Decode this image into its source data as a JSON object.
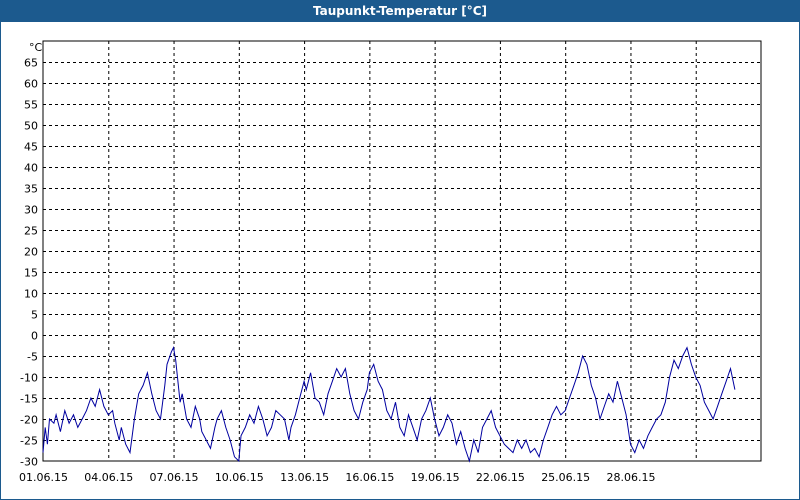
{
  "window": {
    "title": "Taupunkt-Temperatur [°C]"
  },
  "colors": {
    "titlebar": "#1c5a8e",
    "series": "#0000a0",
    "grid": "#000000"
  },
  "chart_data": {
    "type": "line",
    "title": "Taupunkt-Temperatur [°C]",
    "ylabel": "°C",
    "xlabel": "",
    "ylim": [
      -30,
      70
    ],
    "yticks": [
      65,
      60,
      55,
      50,
      45,
      40,
      35,
      30,
      25,
      20,
      15,
      10,
      5,
      0,
      -5,
      -10,
      -15,
      -20,
      -25,
      -30
    ],
    "xlim": [
      "2015-06-01",
      "2015-07-01"
    ],
    "xticks": [
      "01.06.15",
      "04.06.15",
      "07.06.15",
      "10.06.15",
      "13.06.15",
      "16.06.15",
      "19.06.15",
      "22.06.15",
      "25.06.15",
      "28.06.15"
    ],
    "grid": true,
    "series": [
      {
        "x_unit": "day of June 2015",
        "points": [
          [
            1.0,
            -28
          ],
          [
            1.1,
            -22
          ],
          [
            1.2,
            -26
          ],
          [
            1.3,
            -20
          ],
          [
            1.5,
            -21
          ],
          [
            1.6,
            -19
          ],
          [
            1.8,
            -23
          ],
          [
            2.0,
            -18
          ],
          [
            2.2,
            -21
          ],
          [
            2.4,
            -19
          ],
          [
            2.6,
            -22
          ],
          [
            2.8,
            -20
          ],
          [
            3.0,
            -18
          ],
          [
            3.2,
            -15
          ],
          [
            3.4,
            -17
          ],
          [
            3.6,
            -13
          ],
          [
            3.8,
            -17
          ],
          [
            4.0,
            -19
          ],
          [
            4.2,
            -18
          ],
          [
            4.3,
            -21
          ],
          [
            4.5,
            -25
          ],
          [
            4.6,
            -22
          ],
          [
            4.8,
            -26
          ],
          [
            5.0,
            -28
          ],
          [
            5.2,
            -20
          ],
          [
            5.4,
            -14
          ],
          [
            5.6,
            -12
          ],
          [
            5.8,
            -9
          ],
          [
            6.0,
            -14
          ],
          [
            6.2,
            -18
          ],
          [
            6.4,
            -20
          ],
          [
            6.6,
            -12
          ],
          [
            6.7,
            -7
          ],
          [
            6.9,
            -4
          ],
          [
            7.0,
            -3
          ],
          [
            7.1,
            -6
          ],
          [
            7.3,
            -16
          ],
          [
            7.4,
            -14
          ],
          [
            7.6,
            -20
          ],
          [
            7.8,
            -22
          ],
          [
            8.0,
            -17
          ],
          [
            8.2,
            -20
          ],
          [
            8.3,
            -23
          ],
          [
            8.5,
            -25
          ],
          [
            8.7,
            -27
          ],
          [
            8.9,
            -22
          ],
          [
            9.0,
            -20
          ],
          [
            9.2,
            -18
          ],
          [
            9.4,
            -22
          ],
          [
            9.6,
            -25
          ],
          [
            9.8,
            -29
          ],
          [
            10.0,
            -30
          ],
          [
            10.1,
            -24
          ],
          [
            10.3,
            -22
          ],
          [
            10.5,
            -19
          ],
          [
            10.7,
            -21
          ],
          [
            10.9,
            -17
          ],
          [
            11.1,
            -20
          ],
          [
            11.3,
            -24
          ],
          [
            11.5,
            -22
          ],
          [
            11.7,
            -18
          ],
          [
            11.9,
            -19
          ],
          [
            12.1,
            -20
          ],
          [
            12.3,
            -25
          ],
          [
            12.4,
            -22
          ],
          [
            12.6,
            -19
          ],
          [
            12.8,
            -15
          ],
          [
            13.0,
            -11
          ],
          [
            13.1,
            -13
          ],
          [
            13.3,
            -9
          ],
          [
            13.5,
            -15
          ],
          [
            13.7,
            -16
          ],
          [
            13.9,
            -19
          ],
          [
            14.1,
            -14
          ],
          [
            14.3,
            -11
          ],
          [
            14.5,
            -8
          ],
          [
            14.7,
            -10
          ],
          [
            14.9,
            -8
          ],
          [
            15.1,
            -14
          ],
          [
            15.3,
            -18
          ],
          [
            15.5,
            -20
          ],
          [
            15.7,
            -16
          ],
          [
            15.9,
            -13
          ],
          [
            16.0,
            -9
          ],
          [
            16.2,
            -7
          ],
          [
            16.4,
            -11
          ],
          [
            16.6,
            -13
          ],
          [
            16.8,
            -18
          ],
          [
            17.0,
            -20
          ],
          [
            17.2,
            -16
          ],
          [
            17.4,
            -22
          ],
          [
            17.6,
            -24
          ],
          [
            17.8,
            -19
          ],
          [
            18.0,
            -22
          ],
          [
            18.2,
            -25
          ],
          [
            18.4,
            -20
          ],
          [
            18.6,
            -18
          ],
          [
            18.8,
            -15
          ],
          [
            19.0,
            -20
          ],
          [
            19.2,
            -24
          ],
          [
            19.4,
            -22
          ],
          [
            19.6,
            -19
          ],
          [
            19.8,
            -21
          ],
          [
            20.0,
            -26
          ],
          [
            20.2,
            -23
          ],
          [
            20.4,
            -27
          ],
          [
            20.6,
            -30
          ],
          [
            20.8,
            -25
          ],
          [
            21.0,
            -28
          ],
          [
            21.2,
            -22
          ],
          [
            21.4,
            -20
          ],
          [
            21.6,
            -18
          ],
          [
            21.8,
            -22
          ],
          [
            22.0,
            -24
          ],
          [
            22.2,
            -26
          ],
          [
            22.4,
            -27
          ],
          [
            22.6,
            -28
          ],
          [
            22.8,
            -25
          ],
          [
            23.0,
            -27
          ],
          [
            23.2,
            -25
          ],
          [
            23.4,
            -28
          ],
          [
            23.6,
            -27
          ],
          [
            23.8,
            -29
          ],
          [
            24.0,
            -25
          ],
          [
            24.2,
            -22
          ],
          [
            24.4,
            -19
          ],
          [
            24.6,
            -17
          ],
          [
            24.8,
            -19
          ],
          [
            25.0,
            -18
          ],
          [
            25.2,
            -15
          ],
          [
            25.4,
            -12
          ],
          [
            25.6,
            -9
          ],
          [
            25.8,
            -5
          ],
          [
            26.0,
            -7
          ],
          [
            26.2,
            -12
          ],
          [
            26.4,
            -15
          ],
          [
            26.6,
            -20
          ],
          [
            26.8,
            -17
          ],
          [
            27.0,
            -14
          ],
          [
            27.2,
            -16
          ],
          [
            27.4,
            -11
          ],
          [
            27.6,
            -15
          ],
          [
            27.8,
            -19
          ],
          [
            28.0,
            -26
          ],
          [
            28.2,
            -28
          ],
          [
            28.4,
            -25
          ],
          [
            28.6,
            -27
          ],
          [
            28.8,
            -24
          ],
          [
            29.0,
            -22
          ],
          [
            29.2,
            -20
          ],
          [
            29.4,
            -19
          ],
          [
            29.6,
            -16
          ],
          [
            29.8,
            -10
          ],
          [
            30.0,
            -6
          ],
          [
            30.2,
            -8
          ],
          [
            30.4,
            -5
          ],
          [
            30.6,
            -3
          ],
          [
            30.8,
            -7
          ],
          [
            31.0,
            -10
          ],
          [
            31.2,
            -12
          ],
          [
            31.4,
            -16
          ],
          [
            31.6,
            -18
          ],
          [
            31.8,
            -20
          ],
          [
            32.0,
            -17
          ],
          [
            32.2,
            -14
          ],
          [
            32.4,
            -11
          ],
          [
            32.6,
            -8
          ],
          [
            32.8,
            -13
          ]
        ]
      }
    ]
  }
}
